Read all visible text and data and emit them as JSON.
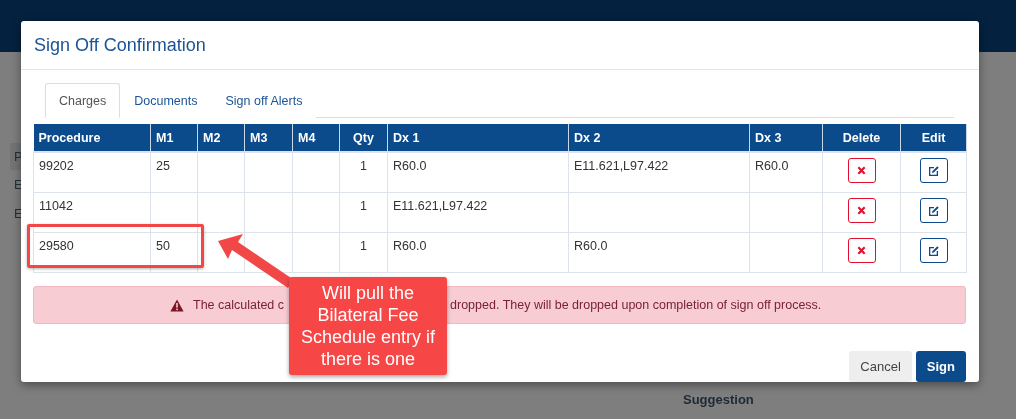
{
  "background": {
    "fragments": [
      {
        "text": "P",
        "kind": "header"
      },
      {
        "text": "E",
        "kind": "row"
      },
      {
        "text": "E",
        "kind": "row"
      }
    ],
    "side_label": "Suggestion"
  },
  "dialog": {
    "title": "Sign Off Confirmation",
    "tabs": [
      {
        "label": "Charges",
        "selected": true
      },
      {
        "label": "Documents",
        "selected": false
      },
      {
        "label": "Sign off Alerts",
        "selected": false
      }
    ],
    "table": {
      "columns": [
        {
          "label": "Procedure",
          "kind": "text"
        },
        {
          "label": "M1",
          "kind": "text"
        },
        {
          "label": "M2",
          "kind": "text"
        },
        {
          "label": "M3",
          "kind": "text"
        },
        {
          "label": "M4",
          "kind": "text"
        },
        {
          "label": "Qty",
          "kind": "number"
        },
        {
          "label": "Dx 1",
          "kind": "text"
        },
        {
          "label": "Dx 2",
          "kind": "text"
        },
        {
          "label": "Dx 3",
          "kind": "text"
        },
        {
          "label": "Delete",
          "kind": "delete"
        },
        {
          "label": "Edit",
          "kind": "edit"
        }
      ],
      "rows": [
        {
          "cells": [
            "99202",
            "25",
            null,
            null,
            null,
            "1",
            "R60.0",
            "E11.621,L97.422",
            "R60.0"
          ]
        },
        {
          "cells": [
            "11042",
            null,
            null,
            null,
            null,
            "1",
            "E11.621,L97.422",
            null,
            null
          ]
        },
        {
          "cells": [
            "29580",
            "50",
            null,
            null,
            null,
            "1",
            "R60.0",
            "R60.0",
            null
          ]
        }
      ]
    },
    "alert": {
      "text_parts": [
        "The calculated c",
        "dropped. They will be dropped upon completion of sign off process."
      ]
    },
    "buttons": [
      {
        "label": "Cancel",
        "kind": "secondary"
      },
      {
        "label": "Sign",
        "kind": "primary"
      }
    ]
  },
  "annotation": {
    "text": "Will pull the Bilateral Fee Schedule entry if there is one"
  }
}
